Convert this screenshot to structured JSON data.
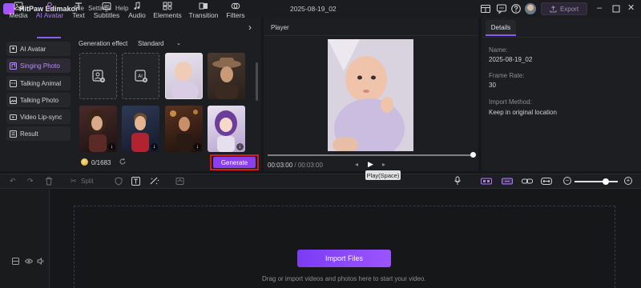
{
  "titlebar": {
    "app_title": "HitPaw Edimakor",
    "menu": [
      "File",
      "Settings",
      "Help"
    ],
    "file_title": "2025-08-19_02",
    "export_label": "Export"
  },
  "tool_tabs": [
    {
      "label": "Media",
      "icon": "media-icon"
    },
    {
      "label": "AI Avatar",
      "icon": "ai-avatar-icon",
      "active": true
    },
    {
      "label": "Text",
      "icon": "text-icon"
    },
    {
      "label": "Subtitles",
      "icon": "subtitles-icon"
    },
    {
      "label": "Audio",
      "icon": "audio-icon"
    },
    {
      "label": "Elements",
      "icon": "elements-icon"
    },
    {
      "label": "Transition",
      "icon": "transition-icon"
    },
    {
      "label": "Filters",
      "icon": "filters-icon"
    }
  ],
  "sidebar": {
    "items": [
      {
        "label": "AI Avatar",
        "icon": "ai-avatar-icon"
      },
      {
        "label": "Singing Photo",
        "icon": "singing-photo-icon",
        "active": true
      },
      {
        "label": "Talking Animal",
        "icon": "talking-animal-icon"
      },
      {
        "label": "Talking Photo",
        "icon": "talking-photo-icon"
      },
      {
        "label": "Video Lip-sync",
        "icon": "video-lipsync-icon"
      },
      {
        "label": "Result",
        "icon": "result-icon"
      }
    ]
  },
  "generation": {
    "effect_label": "Generation effect",
    "effect_value": "Standard",
    "credits": "0/1683",
    "generate_label": "Generate"
  },
  "player": {
    "title": "Player",
    "current_time": "00:03:00",
    "separator": " / ",
    "total_time": "00:03:00",
    "tooltip": "Play(Space)",
    "progress_fraction": 1.0
  },
  "details": {
    "tab": "Details",
    "name_label": "Name:",
    "name_value": "2025-08-19_02",
    "frame_rate_label": "Frame Rate:",
    "frame_rate_value": "30",
    "import_method_label": "Import Method:",
    "import_method_value": "Keep in original location"
  },
  "timeline": {
    "split_label": "Split",
    "import_label": "Import Files",
    "drag_hint": "Drag or import videos and photos here to start your video.",
    "zoom_fraction": 0.7
  },
  "colors": {
    "accent": "#8b5cf6",
    "generate_bg": "#8b3ff0",
    "highlight_outline": "#d21c1c",
    "app_bg": "#161719",
    "panel_bg": "#1d1e21"
  }
}
